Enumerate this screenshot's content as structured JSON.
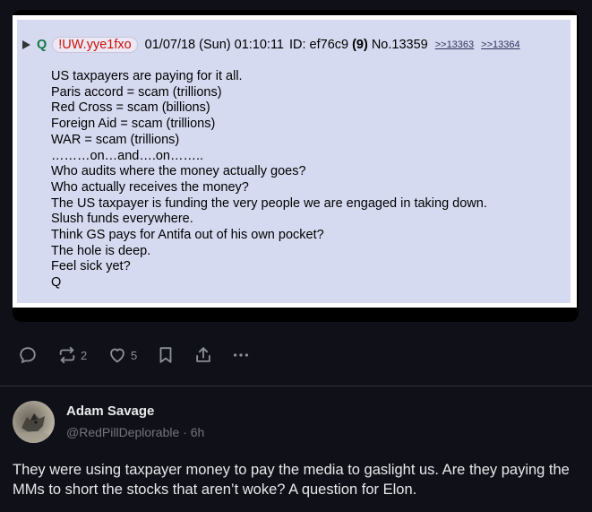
{
  "post": {
    "name": "Q",
    "tripcode": "!UW.yye1fxo",
    "date": "01/07/18 (Sun) 01:10:11",
    "id": "ID: ef76c9",
    "count": "(9)",
    "number": "No.13359",
    "reply_links": [
      ">>13363",
      ">>13364"
    ],
    "lines": [
      "US taxpayers are paying for it all.",
      "Paris accord = scam (trillions)",
      "Red Cross = scam (billions)",
      "Foreign Aid = scam (trillions)",
      "WAR = scam (trillions)",
      "………on…and….on……..",
      "Who audits where the money actually goes?",
      "Who actually receives the money?",
      "The US taxpayer is funding the very people we are engaged in taking down.",
      "Slush funds everywhere.",
      "Think GS pays for Antifa out of his own pocket?",
      "The hole is deep.",
      "Feel sick yet?",
      "Q"
    ]
  },
  "actions": {
    "reply_count": "",
    "repost_count": "2",
    "like_count": "5"
  },
  "reply": {
    "author_name": "Adam Savage",
    "handle": "@RedPillDeplorable",
    "separator": "·",
    "time": "6h",
    "text": "They were using taxpayer money to pay the media to gaslight us. Are they paying the MMs to short the stocks that aren’t woke? A question for Elon."
  },
  "icons": {
    "reply": "comment-bubble-icon",
    "repost": "repost-arrows-icon",
    "like": "heart-icon",
    "bookmark": "bookmark-icon",
    "share": "share-icon",
    "more": "more-dots-icon",
    "post_arrow": "triangle-right-icon"
  },
  "colors": {
    "background": "#101018",
    "post_background": "#d6daf0",
    "name_green": "#117743",
    "tripcode_red": "#cc1105",
    "muted": "#71767b",
    "text": "#e7e9ea"
  }
}
